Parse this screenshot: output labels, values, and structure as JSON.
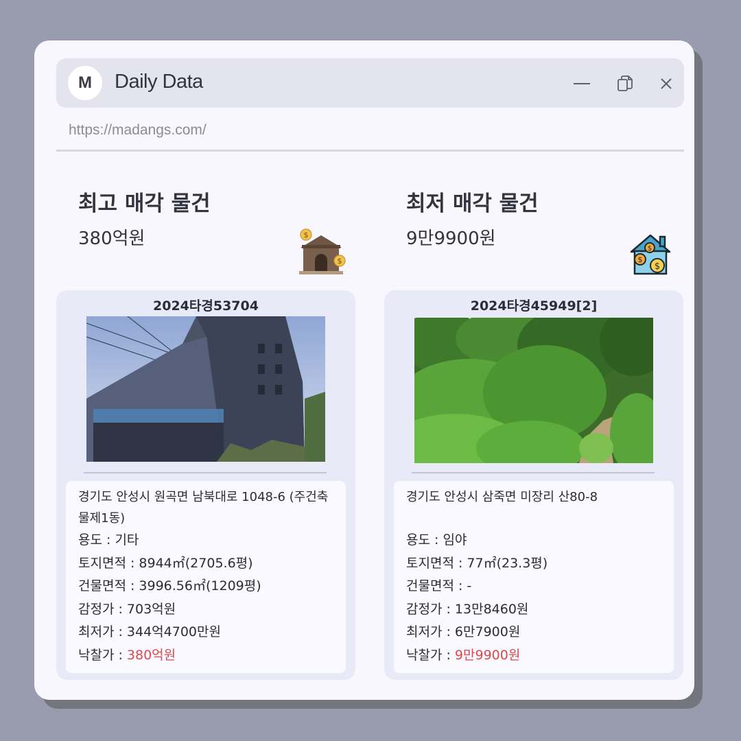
{
  "app": {
    "avatar_letter": "M",
    "title": "Daily Data",
    "url": "https://madangs.com/",
    "controls": [
      "minimize-icon",
      "copy-icon",
      "close-icon"
    ]
  },
  "summary": {
    "highest": {
      "title": "최고 매각 물건",
      "value": "380억원",
      "icon": "house-money-icon"
    },
    "lowest": {
      "title": "최저 매각 물건",
      "value": "9만9900원",
      "icon": "house-coins-icon"
    }
  },
  "cards": [
    {
      "case_no": "2024타경53704",
      "photo": "warehouse-building-photo",
      "address": "경기도 안성시 원곡면 남북대로 1048-6 (주건축물제1동)",
      "usage_label": "용도 : ",
      "usage": "기타",
      "land_label": "토지면적 : ",
      "land": "8944㎡(2705.6평)",
      "building_label": "건물면적 : ",
      "building": "3996.56㎡(1209평)",
      "appraisal_label": "감정가 : ",
      "appraisal": "703억원",
      "minimum_label": "최저가 : ",
      "minimum": "344억4700만원",
      "winning_label": "낙찰가 : ",
      "winning": "380억원"
    },
    {
      "case_no": "2024타경45949[2]",
      "photo": "forest-land-photo",
      "address": "경기도 안성시 삼죽면 미장리 산80-8",
      "usage_label": "용도 : ",
      "usage": "임야",
      "land_label": "토지면적 : ",
      "land": "77㎡(23.3평)",
      "building_label": "건물면적 : ",
      "building": "-",
      "appraisal_label": "감정가 : ",
      "appraisal": "13만8460원",
      "minimum_label": "최저가 : ",
      "minimum": "6만7900원",
      "winning_label": "낙찰가 : ",
      "winning": "9만9900원"
    }
  ],
  "colors": {
    "background": "#999caf",
    "window": "#f7f7fd",
    "titlebar": "#e3e4ee",
    "card": "#e9eaf7",
    "accent_red": "#e04848"
  }
}
